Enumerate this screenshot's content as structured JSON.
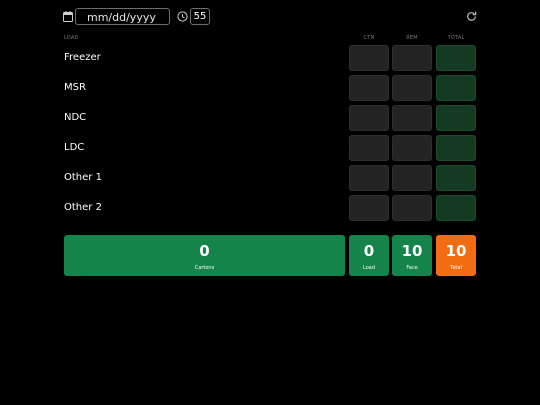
{
  "toolbar": {
    "date_placeholder": "mm/dd/yyyy",
    "minutes_value": "55"
  },
  "table": {
    "headers": {
      "load": "LOAD",
      "ctn": "CTN",
      "rem": "REM",
      "total": "TOTAL"
    },
    "rows": [
      {
        "label": "Freezer",
        "ctn": "",
        "rem": "",
        "total": ""
      },
      {
        "label": "MSR",
        "ctn": "",
        "rem": "",
        "total": ""
      },
      {
        "label": "NDC",
        "ctn": "",
        "rem": "",
        "total": ""
      },
      {
        "label": "LDC",
        "ctn": "",
        "rem": "",
        "total": ""
      },
      {
        "label": "Other 1",
        "ctn": "",
        "rem": "",
        "total": ""
      },
      {
        "label": "Other 2",
        "ctn": "",
        "rem": "",
        "total": ""
      }
    ]
  },
  "summary": {
    "cartons": {
      "value": "0",
      "label": "Cartons"
    },
    "load": {
      "value": "0",
      "label": "Load"
    },
    "face": {
      "value": "10",
      "label": "Face"
    },
    "total": {
      "value": "10",
      "label": "Total"
    }
  },
  "icons": {
    "calendar": "calendar-icon",
    "clock": "clock-icon",
    "refresh": "refresh-icon"
  },
  "colors": {
    "background": "#000000",
    "cell_dark": "#242424",
    "cell_total": "#143a22",
    "summary_green": "#14844a",
    "summary_orange": "#f26d12"
  }
}
